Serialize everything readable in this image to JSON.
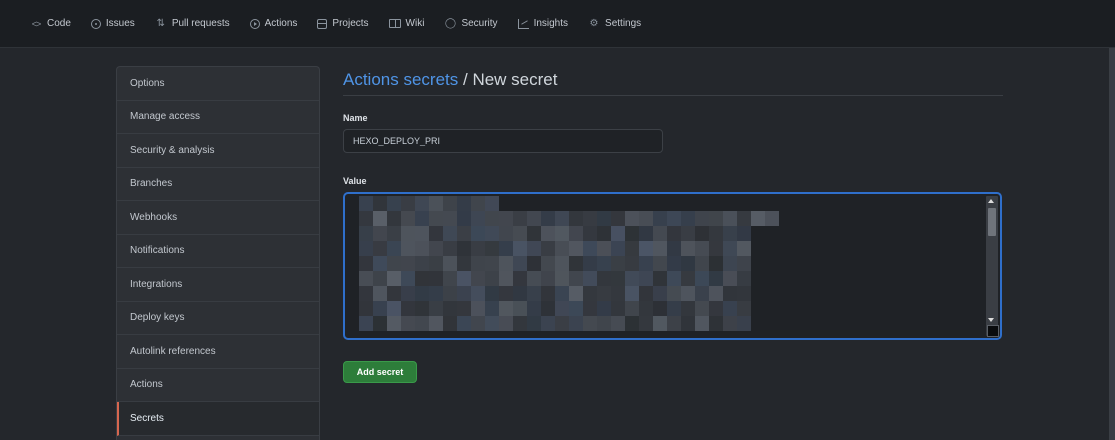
{
  "nav": {
    "items": [
      {
        "label": "Code",
        "icon": "code-icon"
      },
      {
        "label": "Issues",
        "icon": "issue-icon"
      },
      {
        "label": "Pull requests",
        "icon": "pull-request-icon"
      },
      {
        "label": "Actions",
        "icon": "actions-icon"
      },
      {
        "label": "Projects",
        "icon": "project-icon"
      },
      {
        "label": "Wiki",
        "icon": "wiki-icon"
      },
      {
        "label": "Security",
        "icon": "shield-icon"
      },
      {
        "label": "Insights",
        "icon": "graph-icon"
      },
      {
        "label": "Settings",
        "icon": "gear-icon"
      }
    ]
  },
  "menu": {
    "items": [
      {
        "label": "Options"
      },
      {
        "label": "Manage access"
      },
      {
        "label": "Security & analysis"
      },
      {
        "label": "Branches"
      },
      {
        "label": "Webhooks"
      },
      {
        "label": "Notifications"
      },
      {
        "label": "Integrations"
      },
      {
        "label": "Deploy keys"
      },
      {
        "label": "Autolink references"
      },
      {
        "label": "Actions"
      },
      {
        "label": "Secrets",
        "selected": true
      }
    ]
  },
  "main": {
    "breadcrumb": "Actions secrets",
    "separator": " / ",
    "title": "New secret",
    "name_label": "Name",
    "name_value": "HEXO_DEPLOY_PRI",
    "value_label": "Value",
    "submit_label": "Add secret"
  },
  "colors": {
    "accent_link": "#4f94e6",
    "button_green": "#2d7d3a",
    "selected_marker": "#d6664f",
    "focus_border": "#2f6fcb"
  }
}
